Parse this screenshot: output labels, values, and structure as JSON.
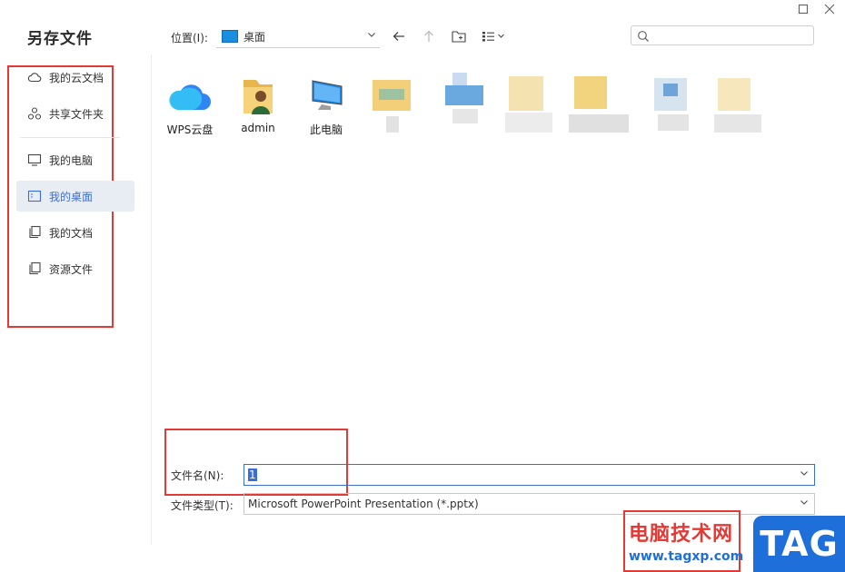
{
  "dialog": {
    "title": "另存文件"
  },
  "window": {
    "maximize_icon": "maximize-icon",
    "close_icon": "close-icon"
  },
  "toolbar": {
    "location_label": "位置(I):",
    "location_value": "桌面",
    "search_placeholder": ""
  },
  "sidebar": {
    "items": [
      {
        "label": "我的云文档",
        "icon": "cloud-icon"
      },
      {
        "label": "共享文件夹",
        "icon": "share-icon"
      },
      {
        "label": "我的电脑",
        "icon": "monitor-icon"
      },
      {
        "label": "我的桌面",
        "icon": "desktop-icon",
        "active": true
      },
      {
        "label": "我的文档",
        "icon": "documents-icon"
      },
      {
        "label": "资源文件",
        "icon": "resource-icon"
      }
    ]
  },
  "files": [
    {
      "name": "WPS云盘",
      "icon": "wps-cloud-icon"
    },
    {
      "name": "admin",
      "icon": "user-folder-icon"
    },
    {
      "name": "此电脑",
      "icon": "computer-icon"
    }
  ],
  "form": {
    "filename_label": "文件名(N):",
    "filename_value": "1",
    "filetype_label": "文件类型(T):",
    "filetype_value": "Microsoft PowerPoint Presentation (*.pptx)"
  },
  "watermark": {
    "title": "电脑技术网",
    "url": "www.tagxp.com",
    "badge": "TAG"
  },
  "colors": {
    "accent": "#3a6fd8",
    "highlight": "#e53935",
    "sidebar_active_bg": "#e8ecf3"
  }
}
